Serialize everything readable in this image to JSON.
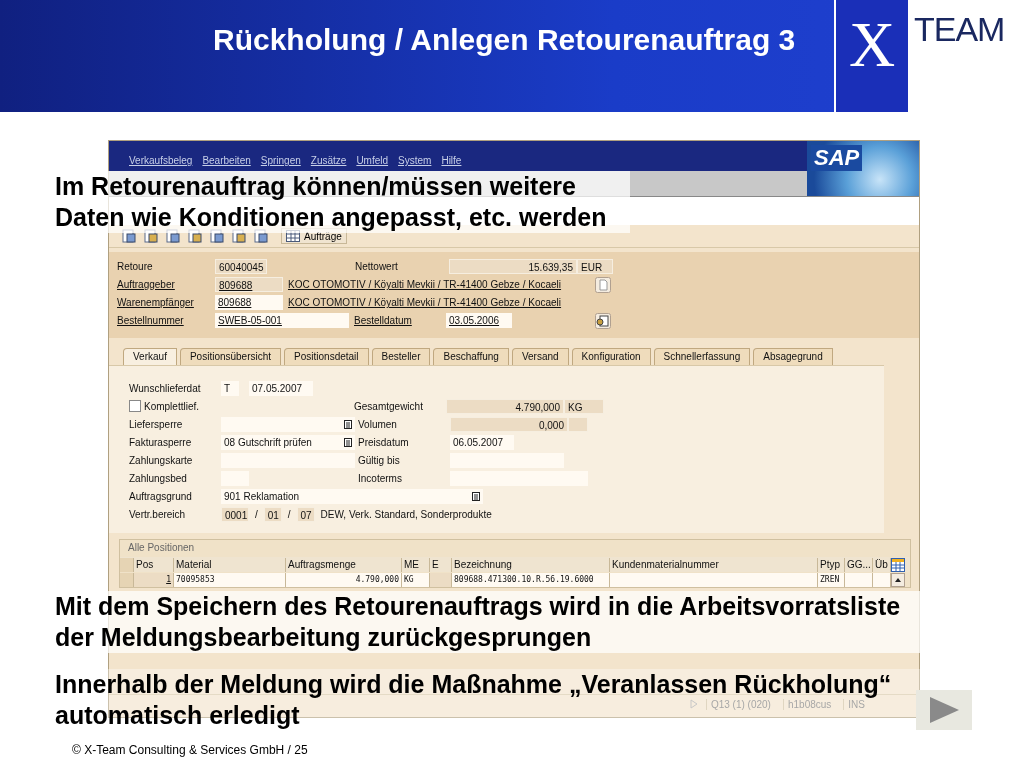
{
  "slide": {
    "title": "Rückholung / Anlegen Retourenauftrag 3",
    "logo": {
      "mark": "X",
      "word": "TEAM"
    },
    "footer": "©  X-Team Consulting & Services GmbH  / 25"
  },
  "sap": {
    "menu": [
      "Verkaufsbeleg",
      "Bearbeiten",
      "Springen",
      "Zusätze",
      "Umfeld",
      "System",
      "Hilfe"
    ],
    "brand": "SAP",
    "orders_button": "Aufträge",
    "header": {
      "order": {
        "label": "Retoure",
        "value": "60040045"
      },
      "net_value": {
        "label": "Nettowert",
        "value": "15.639,35",
        "currency": "EUR"
      },
      "partners": [
        {
          "label": "Auftraggeber",
          "number": "809688",
          "address": "KOC OTOMOTIV / Köyalti Mevkii / TR-41400 Gebze / Kocaeli"
        },
        {
          "label": "Warenempfänger",
          "number": "809688",
          "address": "KOC OTOMOTIV / Köyalti Mevkii / TR-41400 Gebze / Kocaeli"
        }
      ],
      "po_number": {
        "label": "Bestellnummer",
        "value": "SWEB-05-001"
      },
      "po_date": {
        "label": "Bestelldatum",
        "value": "03.05.2006"
      }
    },
    "tabs": [
      {
        "label": "Verkauf",
        "selected": true
      },
      {
        "label": "Positionsübersicht",
        "selected": false
      },
      {
        "label": "Positionsdetail",
        "selected": false
      },
      {
        "label": "Besteller",
        "selected": false
      },
      {
        "label": "Beschaffung",
        "selected": false
      },
      {
        "label": "Versand",
        "selected": false
      },
      {
        "label": "Konfiguration",
        "selected": false
      },
      {
        "label": "Schnellerfassung",
        "selected": false
      },
      {
        "label": "Absagegrund",
        "selected": false
      }
    ],
    "sales": {
      "req_date": {
        "label": "Wunschlieferdat",
        "type": "T",
        "value": "07.05.2007"
      },
      "complete": {
        "label": "Komplettlief.",
        "checked": false
      },
      "weight": {
        "label": "Gesamtgewicht",
        "value": "4.790,000",
        "unit": "KG"
      },
      "delivery_block": {
        "label": "Liefersperre"
      },
      "volume": {
        "label": "Volumen",
        "value": "0,000"
      },
      "billing_block": {
        "label": "Fakturasperre",
        "value": "08 Gutschrift prüfen"
      },
      "price_date": {
        "label": "Preisdatum",
        "value": "06.05.2007"
      },
      "payment_card": {
        "label": "Zahlungskarte"
      },
      "valid_to": {
        "label": "Gültig bis"
      },
      "payment_terms": {
        "label": "Zahlungsbed"
      },
      "incoterms": {
        "label": "Incoterms"
      },
      "reason": {
        "label": "Auftragsgrund",
        "value": "901 Reklamation"
      },
      "sales_area": {
        "label": "Vertr.bereich",
        "org": "0001",
        "sep1": "/",
        "channel": "01",
        "sep2": "/",
        "division": "07",
        "text": "DEW, Verk. Standard, Sonderprodukte"
      }
    },
    "table": {
      "title": "Alle Positionen",
      "columns": [
        "Pos",
        "Material",
        "Auftragsmenge",
        "ME",
        "E",
        "Bezeichnung",
        "Kundenmaterialnummer",
        "Ptyp",
        "GG...",
        "Üb"
      ],
      "rows": [
        {
          "cells": [
            "1",
            "70095853",
            "4.790,000",
            "KG",
            null,
            "809688.471300.10.R.56.19.6000",
            null,
            "ZREN",
            null,
            null
          ]
        }
      ]
    },
    "status": [
      "Q13 (1) (020)",
      "h1b08cus",
      "INS"
    ]
  },
  "callouts": [
    "Im Retourenauftrag können/müssen weitere Daten wie Konditionen angepasst, etc. werden",
    "Mit dem Speichern des Retourenauftrags wird in die Arbeitsvorratsliste der Meldungsbearbeitung zurückgesprungen",
    "Innerhalb der Meldung wird die Maßnahme „Veranlassen Rückholung“ automatisch erledigt"
  ]
}
